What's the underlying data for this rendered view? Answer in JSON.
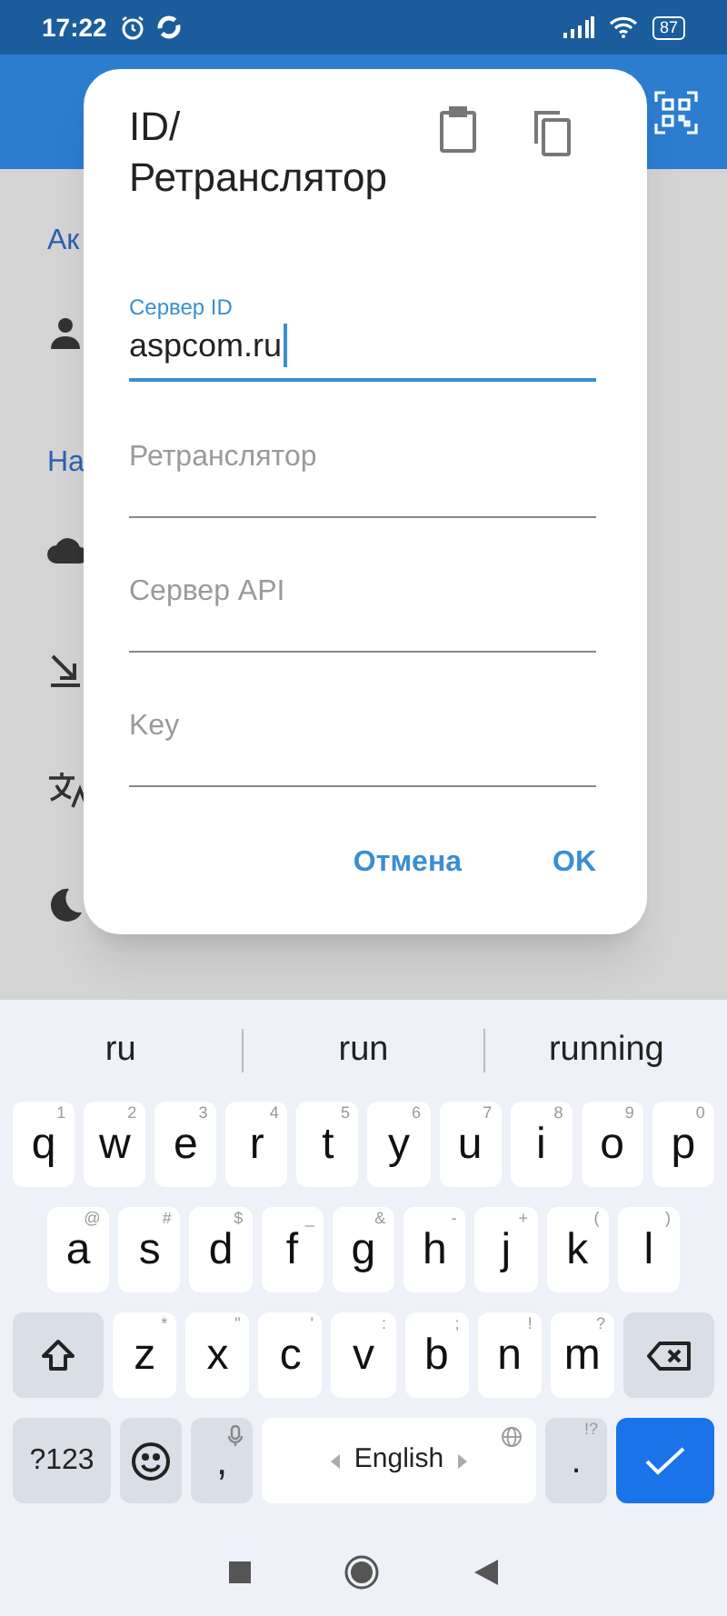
{
  "status_bar": {
    "time": "17:22",
    "battery": "87"
  },
  "background": {
    "sections": [
      {
        "kind": "header",
        "text": "Ак"
      },
      {
        "kind": "person"
      },
      {
        "kind": "header",
        "text": "На"
      },
      {
        "kind": "cloud"
      },
      {
        "kind": "arrow"
      },
      {
        "kind": "translate"
      },
      {
        "kind": "moon"
      }
    ]
  },
  "dialog": {
    "title_lines": [
      "ID/",
      "Ретранслятор"
    ],
    "fields": [
      {
        "kind": "filled",
        "label": "Сервер ID",
        "value": "aspcom.ru",
        "focused": true
      },
      {
        "kind": "empty",
        "placeholder": "Ретранслятор",
        "focused": false
      },
      {
        "kind": "empty",
        "placeholder": "Сервер API",
        "focused": false
      },
      {
        "kind": "empty",
        "placeholder": "Key",
        "focused": false
      }
    ],
    "buttons": [
      "Отмена",
      "OK"
    ]
  },
  "keyboard": {
    "suggestions": [
      "ru",
      "run",
      "running"
    ],
    "rows": [
      {
        "keys": [
          {
            "kind": "letter",
            "label": "q",
            "hint": "1"
          },
          {
            "kind": "letter",
            "label": "w",
            "hint": "2"
          },
          {
            "kind": "letter",
            "label": "e",
            "hint": "3"
          },
          {
            "kind": "letter",
            "label": "r",
            "hint": "4"
          },
          {
            "kind": "letter",
            "label": "t",
            "hint": "5"
          },
          {
            "kind": "letter",
            "label": "y",
            "hint": "6"
          },
          {
            "kind": "letter",
            "label": "u",
            "hint": "7"
          },
          {
            "kind": "letter",
            "label": "i",
            "hint": "8"
          },
          {
            "kind": "letter",
            "label": "o",
            "hint": "9"
          },
          {
            "kind": "letter",
            "label": "p",
            "hint": "0"
          }
        ]
      },
      {
        "keys": [
          {
            "kind": "letter",
            "label": "a",
            "hint": "@"
          },
          {
            "kind": "letter",
            "label": "s",
            "hint": "#"
          },
          {
            "kind": "letter",
            "label": "d",
            "hint": "$"
          },
          {
            "kind": "letter",
            "label": "f",
            "hint": "_"
          },
          {
            "kind": "letter",
            "label": "g",
            "hint": "&"
          },
          {
            "kind": "letter",
            "label": "h",
            "hint": "-"
          },
          {
            "kind": "letter",
            "label": "j",
            "hint": "+"
          },
          {
            "kind": "letter",
            "label": "k",
            "hint": "("
          },
          {
            "kind": "letter",
            "label": "l",
            "hint": ")"
          }
        ]
      },
      {
        "keys": [
          {
            "kind": "shift"
          },
          {
            "kind": "letter",
            "label": "z",
            "hint": "*"
          },
          {
            "kind": "letter",
            "label": "x",
            "hint": "\""
          },
          {
            "kind": "letter",
            "label": "c",
            "hint": "'"
          },
          {
            "kind": "letter",
            "label": "v",
            "hint": ":"
          },
          {
            "kind": "letter",
            "label": "b",
            "hint": ";"
          },
          {
            "kind": "letter",
            "label": "n",
            "hint": "!"
          },
          {
            "kind": "letter",
            "label": "m",
            "hint": "?"
          },
          {
            "kind": "backspace"
          }
        ]
      },
      {
        "keys": [
          {
            "kind": "symbols",
            "label": "?123"
          },
          {
            "kind": "emoji"
          },
          {
            "kind": "comma",
            "label": ","
          },
          {
            "kind": "space",
            "label": "English"
          },
          {
            "kind": "period",
            "label": ".",
            "hint": "!?"
          },
          {
            "kind": "enter"
          }
        ]
      }
    ]
  }
}
